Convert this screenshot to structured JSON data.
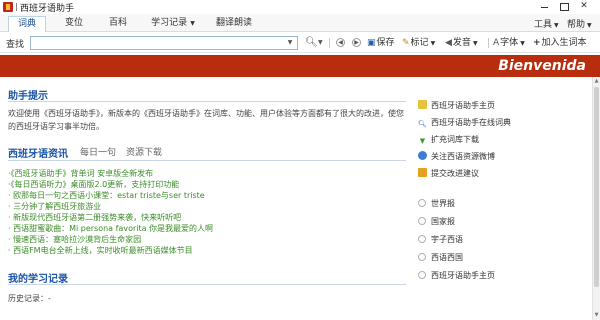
{
  "window": {
    "title": "西班牙语助手"
  },
  "tabs": [
    {
      "label": "词典"
    },
    {
      "label": "变位"
    },
    {
      "label": "百科"
    },
    {
      "label": "学习记录"
    },
    {
      "label": "翻译朗读"
    }
  ],
  "menu_right": {
    "tools": "工具",
    "help": "帮助"
  },
  "toolbar": {
    "search_label": "查找",
    "search_value": "",
    "save_label": "保存",
    "mark_label": "标记",
    "sound_label": "发音",
    "font_label": "字体",
    "add_label": "加入生词本"
  },
  "banner": {
    "text": "Bienvenida"
  },
  "help_section": {
    "title": "助手提示",
    "intro": "欢迎使用《西班牙语助手》，新版本的《西班牙语助手》在词库、功能、用户体验等方面都有了很大的改进，使您的西班牙语学习事半功倍。"
  },
  "news": {
    "tabs": [
      {
        "label": "西班牙语资讯"
      },
      {
        "label": "每日一句"
      },
      {
        "label": "资源下载"
      }
    ],
    "items": [
      "·《西班牙语助手》背单词 安卓版全新发布",
      "·《每日西语听力》桌面版2.0更新，支持打印功能",
      "· 欧那每日一句之西语小课堂：estar triste与ser triste",
      "· 三分钟了解西班牙旅游业",
      "· 新版现代西班牙语第二册强势来袭，快来听听吧",
      "· 西语甜蜜歌曲：Mi persona favorita 你是我最爱的人啊",
      "· 慢速西语：塞哈拉沙漠背后生命家园",
      "· 西语FM电台全新上线，实时收听最新西语媒体节目"
    ]
  },
  "study": {
    "title": "我的学习记录",
    "history_label": "历史记录：-"
  },
  "sidebar": {
    "links": [
      {
        "label": "西班牙语助手主页",
        "icon": "home-icon"
      },
      {
        "label": "西班牙语助手在线词典",
        "icon": "search-icon"
      },
      {
        "label": "扩充词库下载",
        "icon": "download-icon"
      },
      {
        "label": "关注西语资源微博",
        "icon": "weibo-icon"
      },
      {
        "label": "提交改进建议",
        "icon": "note-icon"
      }
    ],
    "options": [
      {
        "label": "世界报"
      },
      {
        "label": "国家报"
      },
      {
        "label": "宇子西语"
      },
      {
        "label": "西语西国"
      },
      {
        "label": "西班牙语助手主页"
      }
    ]
  },
  "colors": {
    "banner_bg": "#b82d0e",
    "section_title": "#1a55a8",
    "news_text": "#3b8e28"
  }
}
